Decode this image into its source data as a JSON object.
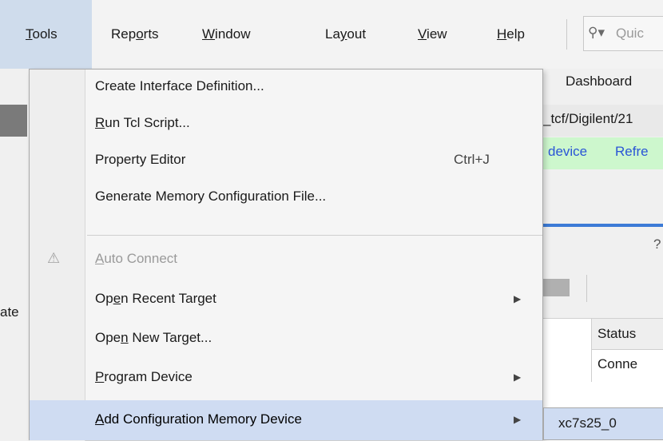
{
  "menubar": {
    "items": [
      {
        "pre": "",
        "u": "T",
        "post": "ools"
      },
      {
        "pre": "Rep",
        "u": "o",
        "post": "rts"
      },
      {
        "pre": "",
        "u": "W",
        "post": "indow"
      },
      {
        "pre": "La",
        "u": "y",
        "post": "out"
      },
      {
        "pre": "",
        "u": "V",
        "post": "iew"
      },
      {
        "pre": "",
        "u": "H",
        "post": "elp"
      }
    ],
    "quick_icon": "search-icon",
    "quick_placeholder": "Quic"
  },
  "background": {
    "dashboard_label": "Dashboard",
    "path_text": "_tcf/Digilent/21",
    "link_device": "device",
    "link_refresh": "Refre",
    "help_mark": "?",
    "left_fragment": "ate",
    "table": {
      "column_header": "Status",
      "cell": "Conne"
    }
  },
  "menu": {
    "items": [
      {
        "pre": "Create Interface Definition...",
        "u": "",
        "post": ""
      },
      {
        "pre": "",
        "u": "R",
        "post": "un Tcl Script..."
      },
      {
        "pre": "Property Editor",
        "u": "",
        "post": "",
        "shortcut": "Ctrl+J"
      },
      {
        "pre": "Generate Memory Confi",
        "u": "g",
        "post": "uration File..."
      },
      {
        "pre": "",
        "u": "A",
        "post": "uto Connect",
        "icon": "plug-icon"
      },
      {
        "pre": "Op",
        "u": "e",
        "post": "n Recent Target"
      },
      {
        "pre": "Ope",
        "u": "n",
        "post": " New Target..."
      },
      {
        "pre": "",
        "u": "P",
        "post": "rogram Device"
      },
      {
        "pre": "",
        "u": "A",
        "post": "dd Configuration Memory Device"
      }
    ]
  },
  "submenu": {
    "items": [
      "xc7s25_0"
    ]
  },
  "colors": {
    "menu_highlight": "#cfdcf2",
    "menubar_active": "#cfdcec",
    "green_row": "#cdf7cd",
    "link": "#2a55d6"
  }
}
